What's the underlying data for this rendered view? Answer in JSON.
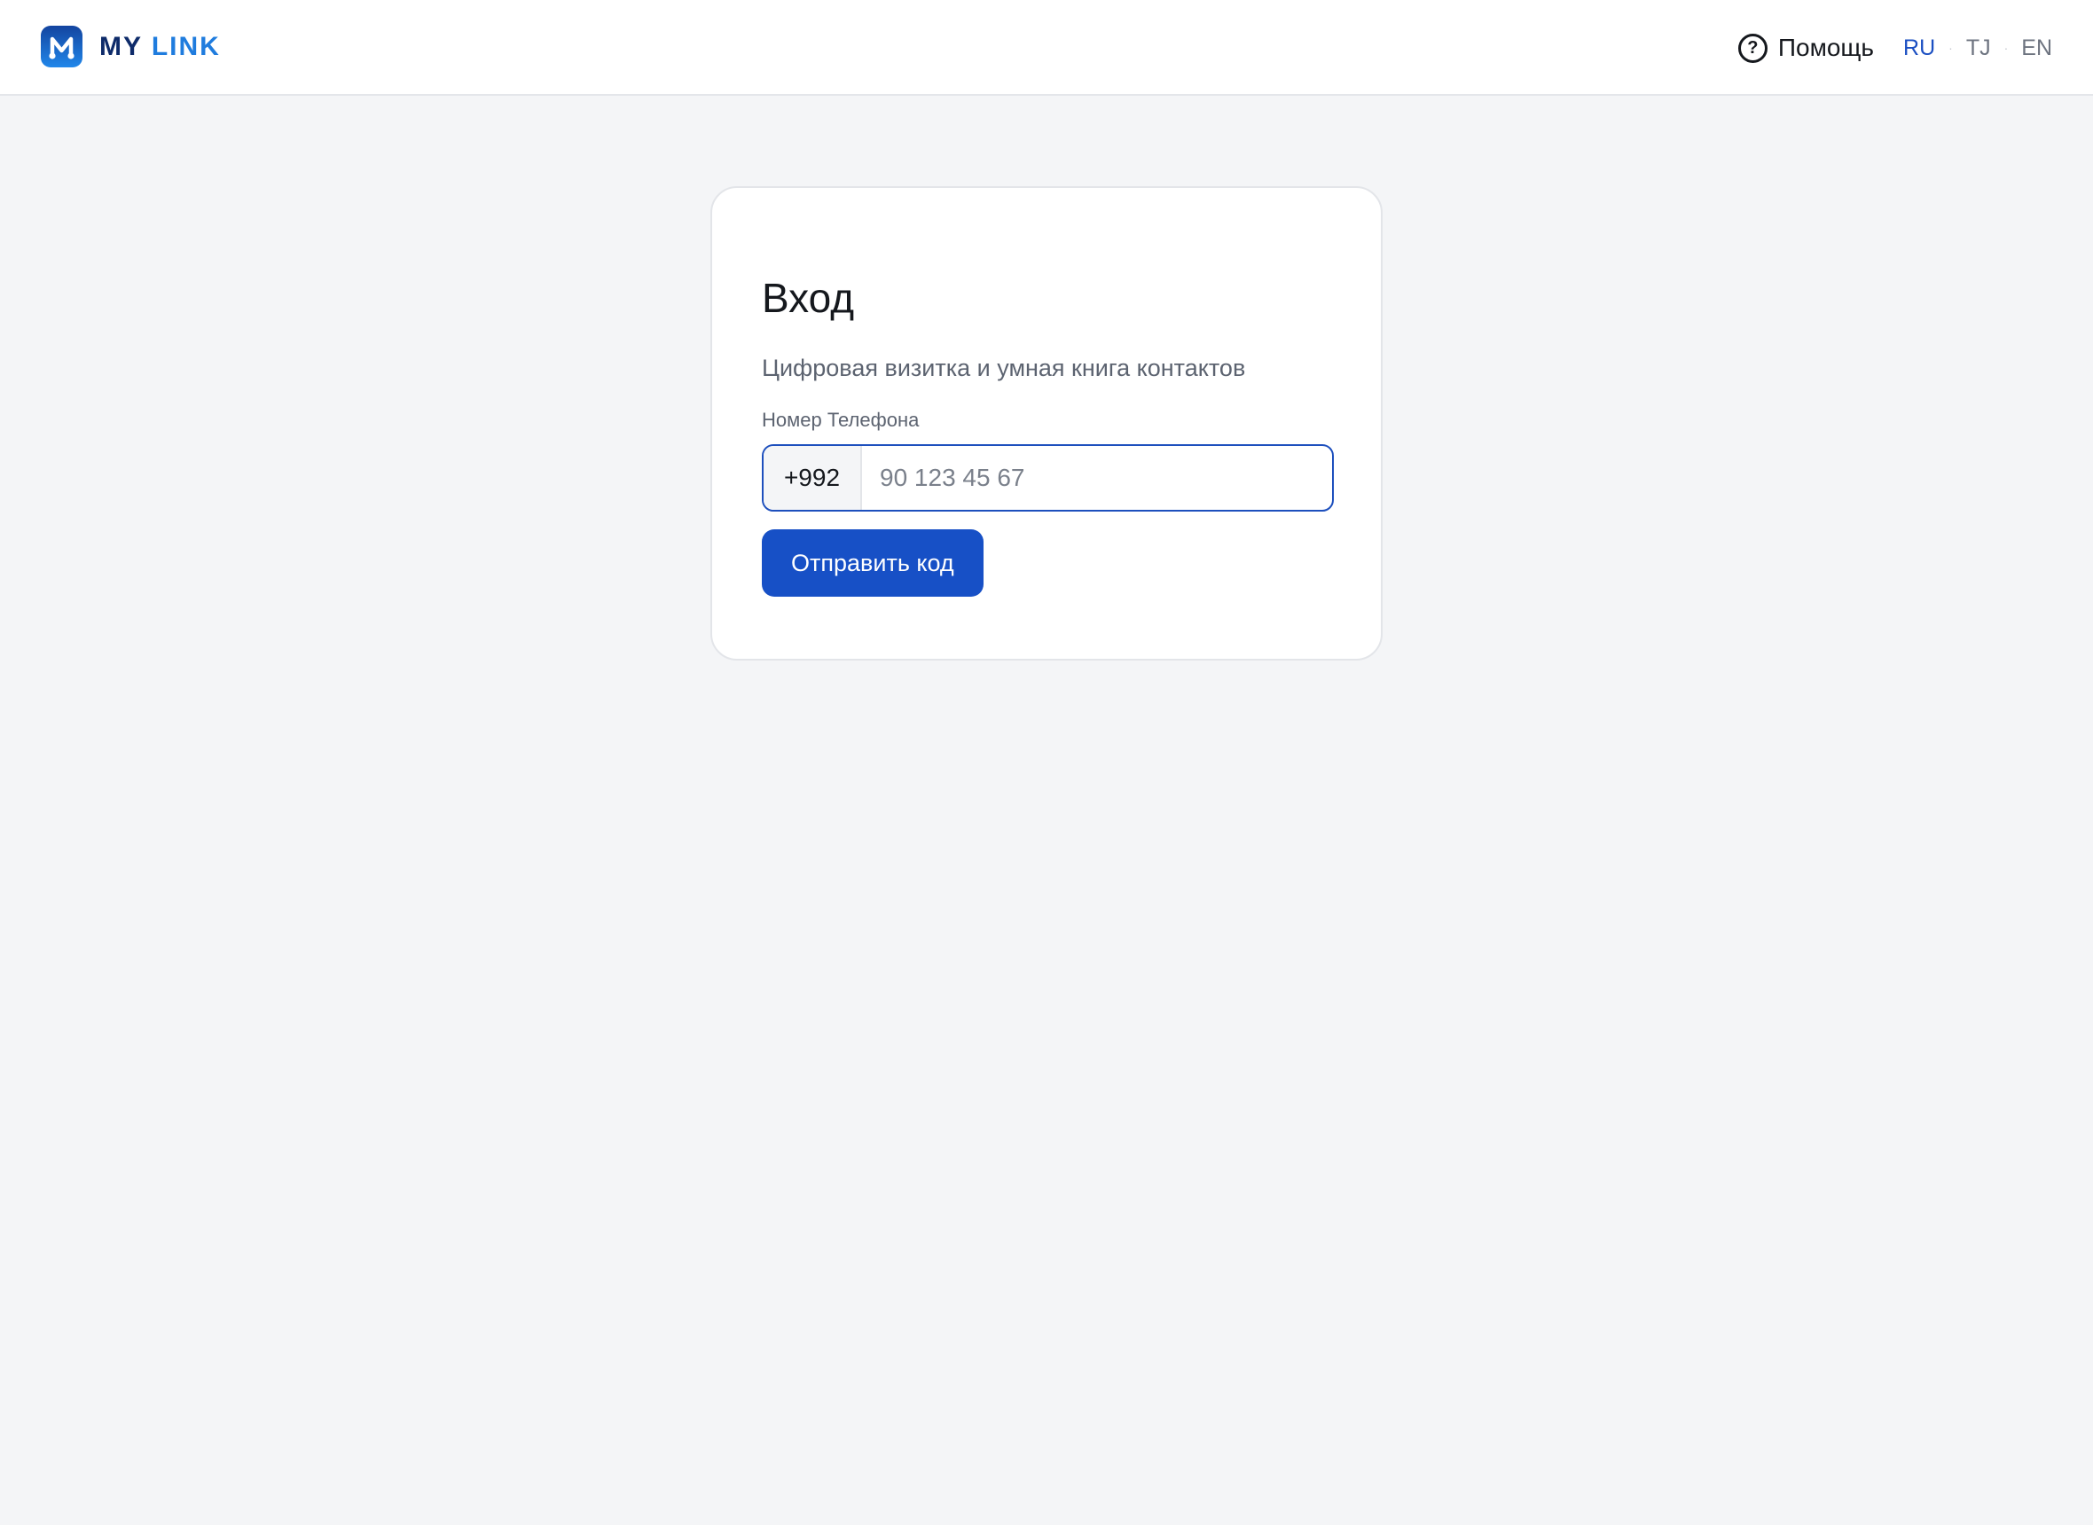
{
  "header": {
    "brand": {
      "name_part1": "MY",
      "name_part2": "LINK",
      "logo_icon": "m-logo-icon"
    },
    "help": {
      "label": "Помощь",
      "icon": "question-circle-icon"
    },
    "languages": [
      "RU",
      "TJ",
      "EN"
    ],
    "active_language": "RU"
  },
  "login": {
    "title": "Вход",
    "subtitle": "Цифровая визитка и умная книга контактов",
    "phone_label": "Номер Телефона",
    "country_code": "+992",
    "phone_value": "",
    "phone_placeholder": "90 123 45 67",
    "submit_label": "Отправить код"
  },
  "colors": {
    "accent": "#1750c6",
    "brand_dark": "#0e2b6a",
    "brand_light": "#1f7cde",
    "background": "#f4f5f7"
  }
}
